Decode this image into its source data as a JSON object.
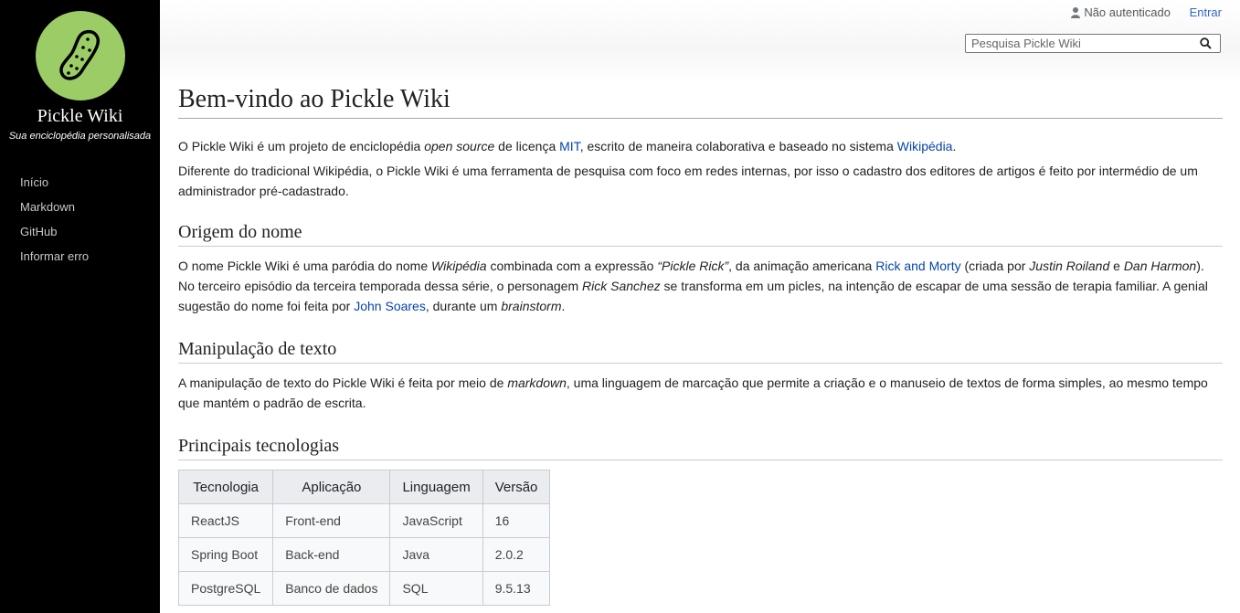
{
  "sidebar": {
    "brand_name": "Pickle Wiki",
    "brand_tagline": "Sua enciclopédia personalisada",
    "logo_icon": "pickle-icon",
    "logo_color": "#9ccc65",
    "nav": [
      {
        "label": "Início"
      },
      {
        "label": "Markdown"
      },
      {
        "label": "GitHub"
      },
      {
        "label": "Informar erro"
      }
    ]
  },
  "header": {
    "user_status": "Não autenticado",
    "login_label": "Entrar",
    "search_placeholder": "Pesquisa Pickle Wiki"
  },
  "page": {
    "title": "Bem-vindo ao Pickle Wiki",
    "intro": {
      "p1_a": "O Pickle Wiki é um projeto de enciclopédia ",
      "p1_em": "open source",
      "p1_b": " de licença ",
      "p1_link1": "MIT",
      "p1_c": ", escrito de maneira colaborativa e baseado no sistema ",
      "p1_link2": "Wikipédia",
      "p1_d": ".",
      "p2": "Diferente do tradicional Wikipédia, o Pickle Wiki é uma ferramenta de pesquisa com foco em redes internas, por isso o cadastro dos editores de artigos é feito por intermédio de um administrador pré-cadastrado."
    },
    "origin": {
      "heading": "Origem do nome",
      "a": "O nome Pickle Wiki é uma paródia do nome ",
      "em1": "Wikipédia",
      "b": " combinada com a expressão ",
      "em2": "“Pickle Rick”",
      "c": ", da animação americana ",
      "link1": "Rick and Morty",
      "d": " (criada por ",
      "em3": "Justin Roiland",
      "e": " e ",
      "em4": "Dan Harmon",
      "f": "). No terceiro episódio da terceira temporada dessa série, o personagem ",
      "em5": "Rick Sanchez",
      "g": " se transforma em um picles, na intenção de escapar de uma sessão de terapia familiar. A genial sugestão do nome foi feita por ",
      "link2": "John Soares",
      "h": ", durante um ",
      "em6": "brainstorm",
      "i": "."
    },
    "manip": {
      "heading": "Manipulação de texto",
      "a": "A manipulação de texto do Pickle Wiki é feita por meio de ",
      "em": "markdown",
      "b": ", uma linguagem de marcação que permite a criação e o manuseio de textos de forma simples, ao mesmo tempo que mantém o padrão de escrita."
    },
    "tech": {
      "heading": "Principais tecnologias",
      "columns": [
        "Tecnologia",
        "Aplicação",
        "Linguagem",
        "Versão"
      ],
      "rows": [
        [
          "ReactJS",
          "Front-end",
          "JavaScript",
          "16"
        ],
        [
          "Spring Boot",
          "Back-end",
          "Java",
          "2.0.2"
        ],
        [
          "PostgreSQL",
          "Banco de dados",
          "SQL",
          "9.5.13"
        ]
      ]
    }
  },
  "colors": {
    "sidebar_bg": "#000000",
    "link": "#0645ad",
    "login_link": "#3366cc"
  }
}
